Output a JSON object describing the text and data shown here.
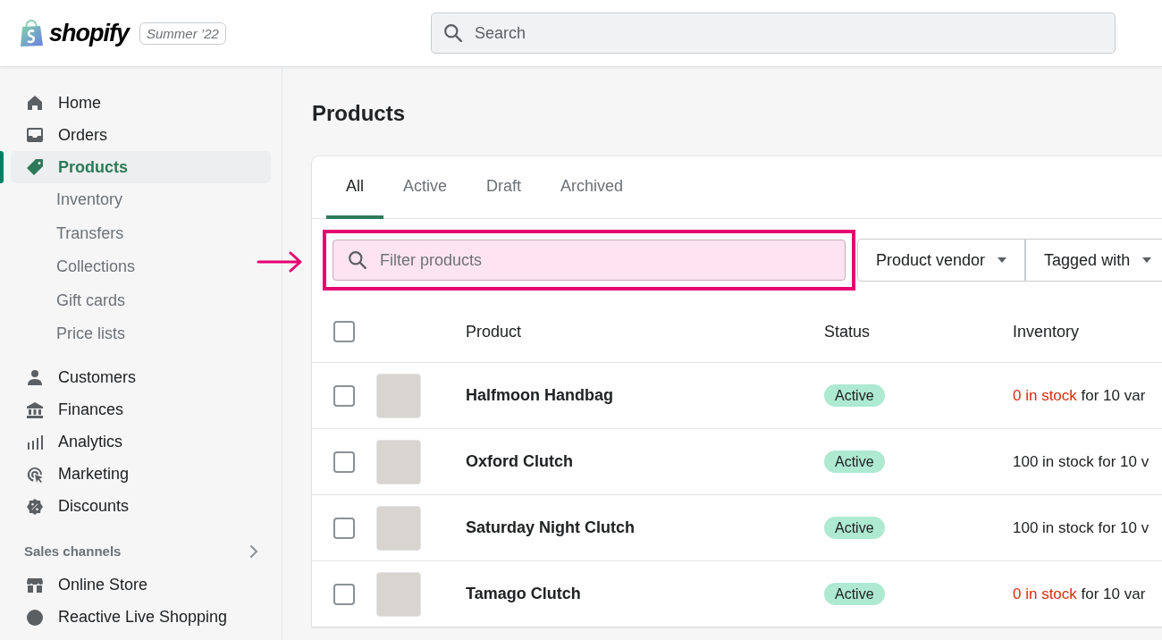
{
  "topbar": {
    "logo": "shopify",
    "edition_badge": "Summer ’22",
    "search": {
      "placeholder": "Search"
    }
  },
  "sidebar": {
    "items": [
      {
        "label": "Home",
        "selected": false
      },
      {
        "label": "Orders",
        "selected": false
      },
      {
        "label": "Products",
        "selected": true,
        "children": [
          {
            "label": "Inventory"
          },
          {
            "label": "Transfers"
          },
          {
            "label": "Collections"
          },
          {
            "label": "Gift cards"
          },
          {
            "label": "Price lists"
          }
        ]
      },
      {
        "label": "Customers",
        "selected": false
      },
      {
        "label": "Finances",
        "selected": false
      },
      {
        "label": "Analytics",
        "selected": false
      },
      {
        "label": "Marketing",
        "selected": false
      },
      {
        "label": "Discounts",
        "selected": false
      }
    ],
    "sales_channels": {
      "label": "Sales channels",
      "items": [
        {
          "label": "Online Store"
        },
        {
          "label": "Reactive Live Shopping"
        }
      ]
    }
  },
  "page": {
    "title": "Products"
  },
  "tabs": [
    {
      "label": "All",
      "selected": true
    },
    {
      "label": "Active",
      "selected": false
    },
    {
      "label": "Draft",
      "selected": false
    },
    {
      "label": "Archived",
      "selected": false
    }
  ],
  "filter": {
    "placeholder": "Filter products",
    "highlighted": true
  },
  "filter_buttons": [
    {
      "label": "Product vendor"
    },
    {
      "label": "Tagged with"
    }
  ],
  "table": {
    "select_all_checked": false,
    "columns": [
      "Product",
      "Status",
      "Inventory"
    ],
    "rows": [
      {
        "checked": false,
        "name": "Halfmoon Handbag",
        "status": "Active",
        "stock": "0 in stock",
        "out_of_stock": true,
        "variants": "for 10 var"
      },
      {
        "checked": false,
        "name": "Oxford Clutch",
        "status": "Active",
        "stock": "100 in stock",
        "out_of_stock": false,
        "variants": "for 10 v"
      },
      {
        "checked": false,
        "name": "Saturday Night Clutch",
        "status": "Active",
        "stock": "100 in stock",
        "out_of_stock": false,
        "variants": "for 10 v"
      },
      {
        "checked": false,
        "name": "Tamago Clutch",
        "status": "Active",
        "stock": "0 in stock",
        "out_of_stock": true,
        "variants": "for 10 var"
      }
    ]
  }
}
